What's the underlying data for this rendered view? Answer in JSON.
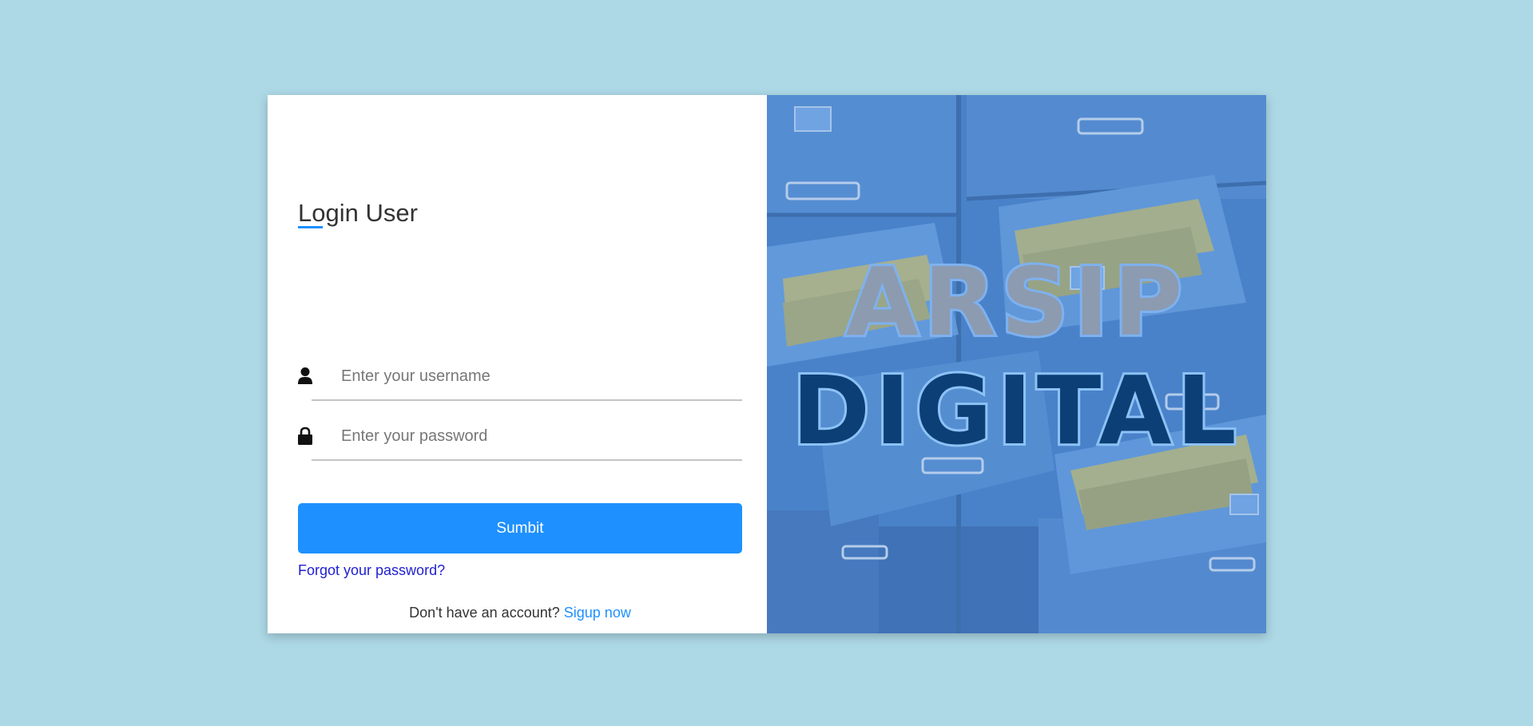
{
  "login": {
    "title": "Login User",
    "username_placeholder": "Enter your username",
    "password_placeholder": "Enter your password",
    "submit_label": "Sumbit",
    "forgot_label": "Forgot your password?",
    "signup_prompt": "Don't have an account?",
    "signup_link": "Sigup now"
  },
  "brand": {
    "line1": "ARSIP",
    "line2": "DIGITAL"
  },
  "icons": {
    "username": "user-icon",
    "password": "lock-icon"
  },
  "colors": {
    "background": "#add8e6",
    "accent": "#1e90ff",
    "forgot_link": "#1f1fd0",
    "brand_line1": "#8c9bb0",
    "brand_line2": "#0d3f77"
  }
}
